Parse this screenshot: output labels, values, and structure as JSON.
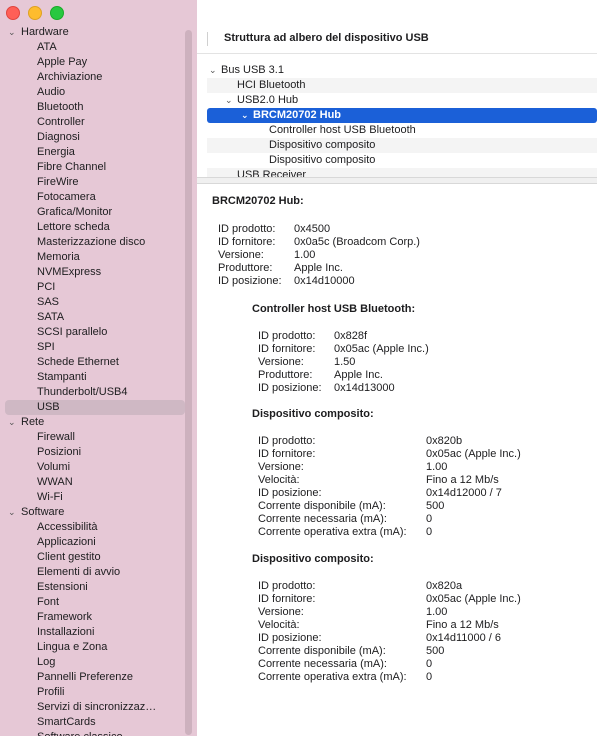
{
  "sidebar": {
    "categories": [
      {
        "label": "Hardware",
        "items": [
          "ATA",
          "Apple Pay",
          "Archiviazione",
          "Audio",
          "Bluetooth",
          "Controller",
          "Diagnosi",
          "Energia",
          "Fibre Channel",
          "FireWire",
          "Fotocamera",
          "Grafica/Monitor",
          "Lettore scheda",
          "Masterizzazione disco",
          "Memoria",
          "NVMExpress",
          "PCI",
          "SAS",
          "SATA",
          "SCSI parallelo",
          "SPI",
          "Schede Ethernet",
          "Stampanti",
          "Thunderbolt/USB4",
          "USB"
        ]
      },
      {
        "label": "Rete",
        "items": [
          "Firewall",
          "Posizioni",
          "Volumi",
          "WWAN",
          "Wi-Fi"
        ]
      },
      {
        "label": "Software",
        "items": [
          "Accessibilità",
          "Applicazioni",
          "Client gestito",
          "Elementi di avvio",
          "Estensioni",
          "Font",
          "Framework",
          "Installazioni",
          "Lingua e Zona",
          "Log",
          "Pannelli Preferenze",
          "Profili",
          "Servizi di sincronizzaz…",
          "SmartCards",
          "Software classico"
        ]
      }
    ],
    "selected": "USB"
  },
  "header": {
    "title": "Struttura ad albero del dispositivo USB"
  },
  "usb_tree": [
    {
      "label": "Bus USB 3.1",
      "level": 0,
      "chev": "⌄"
    },
    {
      "label": "HCI Bluetooth",
      "level": 1,
      "chev": ""
    },
    {
      "label": "USB2.0 Hub",
      "level": 1,
      "chev": "⌄"
    },
    {
      "label": "BRCM20702 Hub",
      "level": 2,
      "chev": "⌄"
    },
    {
      "label": "Controller host USB Bluetooth",
      "level": 3,
      "chev": ""
    },
    {
      "label": "Dispositivo composito",
      "level": 3,
      "chev": ""
    },
    {
      "label": "Dispositivo composito",
      "level": 3,
      "chev": ""
    },
    {
      "label": "USB Receiver",
      "level": 1,
      "chev": ""
    }
  ],
  "details": {
    "title": "BRCM20702 Hub:",
    "props": [
      [
        "ID prodotto:",
        "0x4500"
      ],
      [
        "ID fornitore:",
        "0x0a5c  (Broadcom Corp.)"
      ],
      [
        "Versione:",
        "1.00"
      ],
      [
        "Produttore:",
        "Apple Inc."
      ],
      [
        "ID posizione:",
        "0x14d10000"
      ]
    ],
    "children": [
      {
        "title": "Controller host USB Bluetooth:",
        "props": [
          [
            "ID prodotto:",
            "0x828f"
          ],
          [
            "ID fornitore:",
            "0x05ac (Apple Inc.)"
          ],
          [
            "Versione:",
            "1.50"
          ],
          [
            "Produttore:",
            "Apple Inc."
          ],
          [
            "ID posizione:",
            "0x14d13000"
          ]
        ]
      },
      {
        "title": "Dispositivo composito:",
        "props": [
          [
            "ID prodotto:",
            "0x820b"
          ],
          [
            "ID fornitore:",
            "0x05ac (Apple Inc.)"
          ],
          [
            "Versione:",
            "1.00"
          ],
          [
            "Velocità:",
            "Fino a 12 Mb/s"
          ],
          [
            "ID posizione:",
            "0x14d12000 / 7"
          ],
          [
            "Corrente disponibile (mA):",
            "500"
          ],
          [
            "Corrente necessaria (mA):",
            "0"
          ],
          [
            "Corrente operativa extra (mA):",
            "0"
          ]
        ]
      },
      {
        "title": "Dispositivo composito:",
        "props": [
          [
            "ID prodotto:",
            "0x820a"
          ],
          [
            "ID fornitore:",
            "0x05ac (Apple Inc.)"
          ],
          [
            "Versione:",
            "1.00"
          ],
          [
            "Velocità:",
            "Fino a 12 Mb/s"
          ],
          [
            "ID posizione:",
            "0x14d11000 / 6"
          ],
          [
            "Corrente disponibile (mA):",
            "500"
          ],
          [
            "Corrente necessaria (mA):",
            "0"
          ],
          [
            "Corrente operativa extra (mA):",
            "0"
          ]
        ]
      }
    ]
  }
}
